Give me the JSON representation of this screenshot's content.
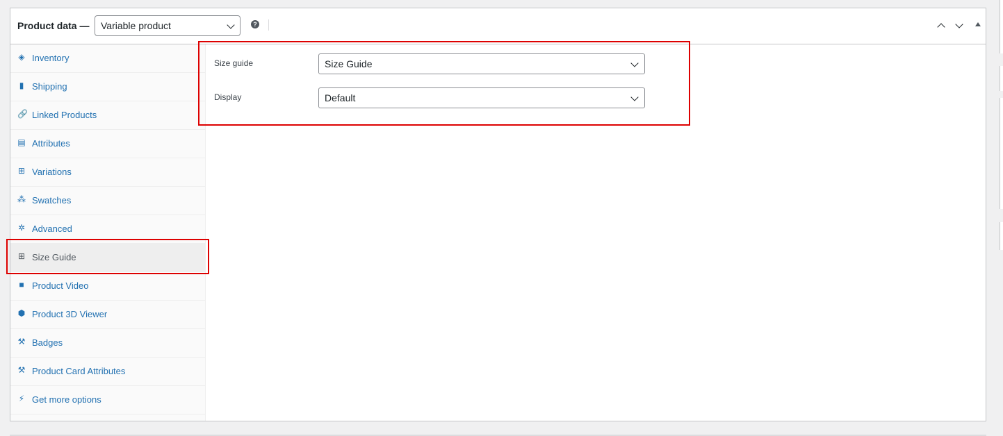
{
  "header": {
    "title": "Product data —",
    "product_type": "Variable product",
    "help_glyph": "?"
  },
  "tabs": [
    {
      "label": "Inventory",
      "icon": "tag-icon",
      "glyph": "◈"
    },
    {
      "label": "Shipping",
      "icon": "truck-icon",
      "glyph": "▮"
    },
    {
      "label": "Linked Products",
      "icon": "link-icon",
      "glyph": "🔗"
    },
    {
      "label": "Attributes",
      "icon": "list-icon",
      "glyph": "▤"
    },
    {
      "label": "Variations",
      "icon": "grid-icon",
      "glyph": "⊞"
    },
    {
      "label": "Swatches",
      "icon": "swatches-icon",
      "glyph": "⁂"
    },
    {
      "label": "Advanced",
      "icon": "gear-icon",
      "glyph": "✲"
    },
    {
      "label": "Size Guide",
      "icon": "table-icon",
      "glyph": "⊞"
    },
    {
      "label": "Product Video",
      "icon": "video-icon",
      "glyph": "■"
    },
    {
      "label": "Product 3D Viewer",
      "icon": "cube-icon",
      "glyph": "⬢"
    },
    {
      "label": "Badges",
      "icon": "wrench-icon",
      "glyph": "⚒"
    },
    {
      "label": "Product Card Attributes",
      "icon": "wrench-icon",
      "glyph": "⚒"
    },
    {
      "label": "Get more options",
      "icon": "plugin-icon",
      "glyph": "⚡"
    }
  ],
  "active_tab": "Size Guide",
  "fields": {
    "size_guide": {
      "label": "Size guide",
      "value": "Size Guide"
    },
    "display": {
      "label": "Display",
      "value": "Default"
    }
  },
  "colors": {
    "link": "#2271b1",
    "highlight": "#dd0000"
  }
}
